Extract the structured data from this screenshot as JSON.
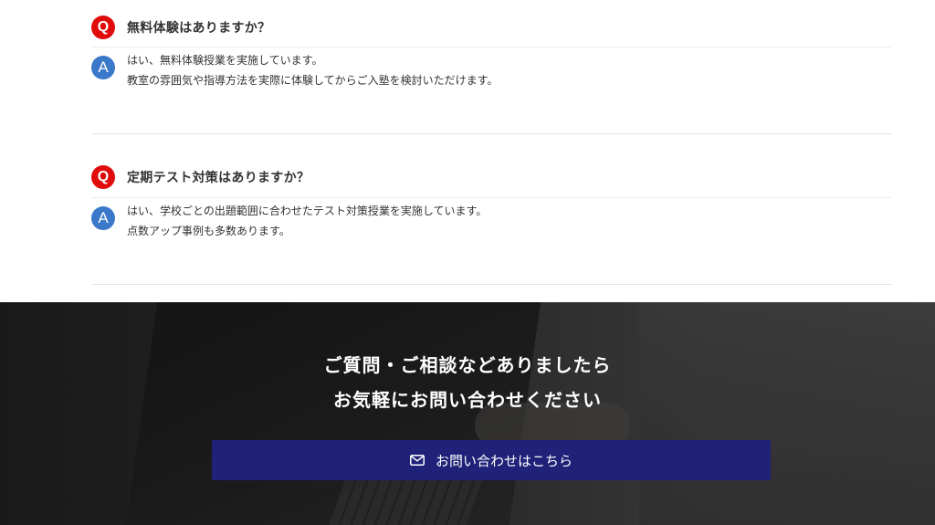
{
  "faq": [
    {
      "q_badge": "Q",
      "question": "無料体験はありますか？",
      "a_badge": "A",
      "answer_lines": [
        "はい、無料体験授業を実施しています。",
        "教室の雰囲気や指導方法を実際に体験してからご入塾を検討いただけます。"
      ]
    },
    {
      "q_badge": "Q",
      "question": "定期テスト対策はありますか？",
      "a_badge": "A",
      "answer_lines": [
        "はい、学校ごとの出題範囲に合わせたテスト対策授業を実施しています。",
        "点数アップ事例も多数あります。"
      ]
    }
  ],
  "cta": {
    "heading_line1": "ご質問・ご相談などありましたら",
    "heading_line2": "お気軽にお問い合わせください",
    "button_label": "お問い合わせはこちら",
    "button_icon": "mail-icon"
  },
  "colors": {
    "q_badge": "#e00b0b",
    "a_badge": "#3a78c9",
    "button": "#1f2278"
  }
}
